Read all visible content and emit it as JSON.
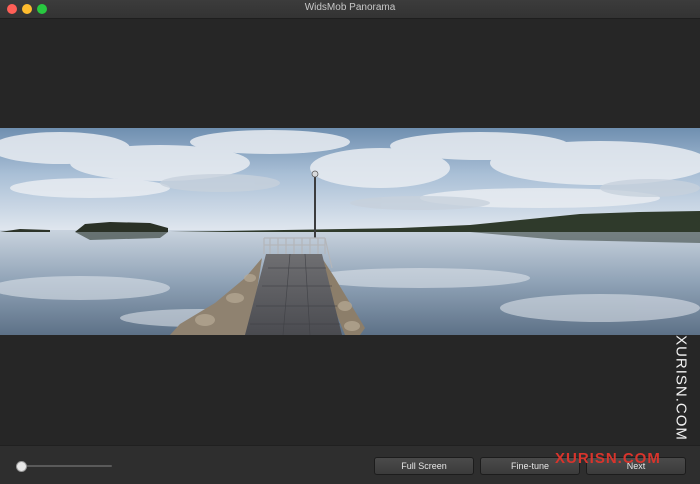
{
  "window": {
    "title": "WidsMob Panorama"
  },
  "toolbar": {
    "full_screen_label": "Full Screen",
    "fine_tune_label": "Fine-tune",
    "next_label": "Next",
    "zoom_level": 0.0
  },
  "watermark": {
    "side_text": "XURISN.COM",
    "bottom_text": "XURISN.COM"
  },
  "colors": {
    "close": "#ff5f57",
    "minimize": "#febc2e",
    "maximize": "#28c840",
    "background": "#262626"
  }
}
